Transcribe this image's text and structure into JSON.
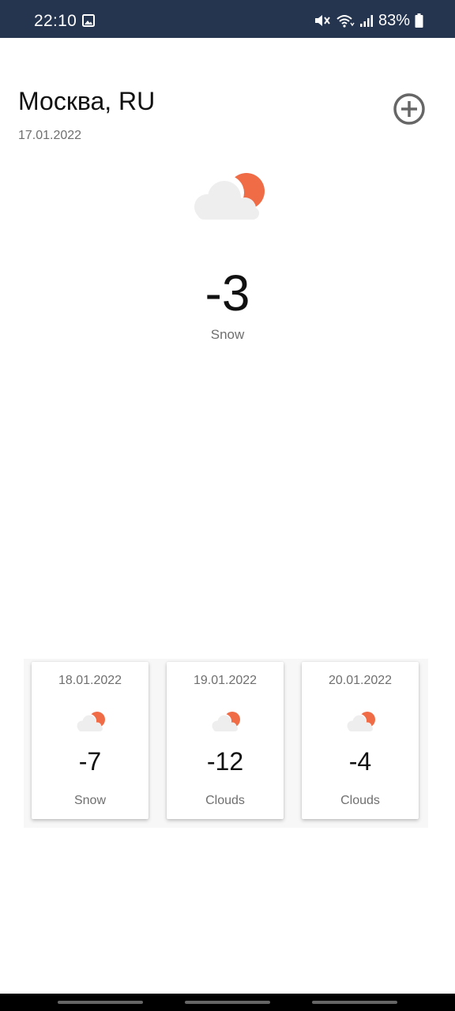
{
  "status_bar": {
    "time": "22:10",
    "battery": "83%",
    "icons": [
      "gallery-icon",
      "mute-icon",
      "wifi-icon",
      "signal-icon",
      "battery-icon"
    ]
  },
  "location": {
    "city": "Москва, RU",
    "date": "17.01.2022"
  },
  "current": {
    "icon": "cloud-sun-icon",
    "temp": "-3",
    "description": "Snow"
  },
  "forecast": [
    {
      "date": "18.01.2022",
      "icon": "cloud-sun-icon",
      "temp": "-7",
      "description": "Snow"
    },
    {
      "date": "19.01.2022",
      "icon": "cloud-sun-icon",
      "temp": "-12",
      "description": "Clouds"
    },
    {
      "date": "20.01.2022",
      "icon": "cloud-sun-icon",
      "temp": "-4",
      "description": "Clouds"
    }
  ],
  "colors": {
    "status_bar_bg": "#253550",
    "sun": "#ef6c47",
    "cloud": "#eeeeee",
    "secondary_text": "#6f6f6f"
  }
}
